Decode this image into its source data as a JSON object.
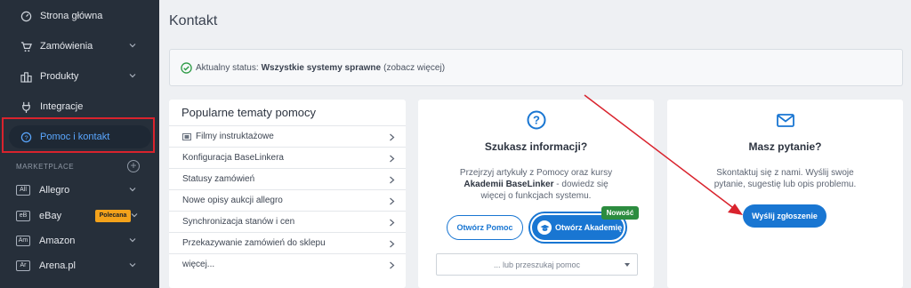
{
  "sidebar": {
    "items": [
      {
        "label": "Strona główna",
        "icon": "dashboard-icon"
      },
      {
        "label": "Zamówienia",
        "icon": "cart-icon"
      },
      {
        "label": "Produkty",
        "icon": "products-icon"
      },
      {
        "label": "Integracje",
        "icon": "plug-icon"
      },
      {
        "label": "Pomoc i kontakt",
        "icon": "help-icon"
      }
    ],
    "section_label": "MARKETPLACE",
    "add_symbol": "+",
    "marketplaces": [
      {
        "badge": "All",
        "label": "Allegro"
      },
      {
        "badge": "eB",
        "label": "eBay",
        "tag": "Polecana"
      },
      {
        "badge": "Am",
        "label": "Amazon"
      },
      {
        "badge": "Ar",
        "label": "Arena.pl"
      }
    ]
  },
  "page": {
    "title": "Kontakt"
  },
  "status": {
    "prefix": "Aktualny status:",
    "value": "Wszystkie systemy sprawne",
    "link": "(zobacz więcej)"
  },
  "help_topics": {
    "title": "Popularne tematy pomocy",
    "items": [
      "Filmy instruktażowe",
      "Konfiguracja BaseLinkera",
      "Statusy zamówień",
      "Nowe opisy aukcji allegro",
      "Synchronizacja stanów i cen",
      "Przekazywanie zamówień do sklepu",
      "więcej..."
    ]
  },
  "search_card": {
    "title": "Szukasz informacji?",
    "text_line1": "Przejrzyj artykuły z Pomocy oraz kursy",
    "text_strong": "Akademii BaseLinker",
    "text_line2_rest": " - dowiedz się",
    "text_line3": "więcej o funkcjach systemu.",
    "btn_help": "Otwórz Pomoc",
    "btn_academy": "Otwórz Akademię",
    "badge_new": "Nowość",
    "search_placeholder": "... lub przeszukaj pomoc"
  },
  "question_card": {
    "title": "Masz pytanie?",
    "text_line1": "Skontaktuj się z nami. Wyślij swoje",
    "text_line2": "pytanie, sugestię lub opis problemu.",
    "btn_send": "Wyślij zgłoszenie"
  },
  "colors": {
    "sidebar_bg": "#262f3a",
    "accent": "#1976d2",
    "highlight_red": "#d9232d",
    "badge_green": "#2c8c3f",
    "badge_orange": "#f3a21b"
  }
}
